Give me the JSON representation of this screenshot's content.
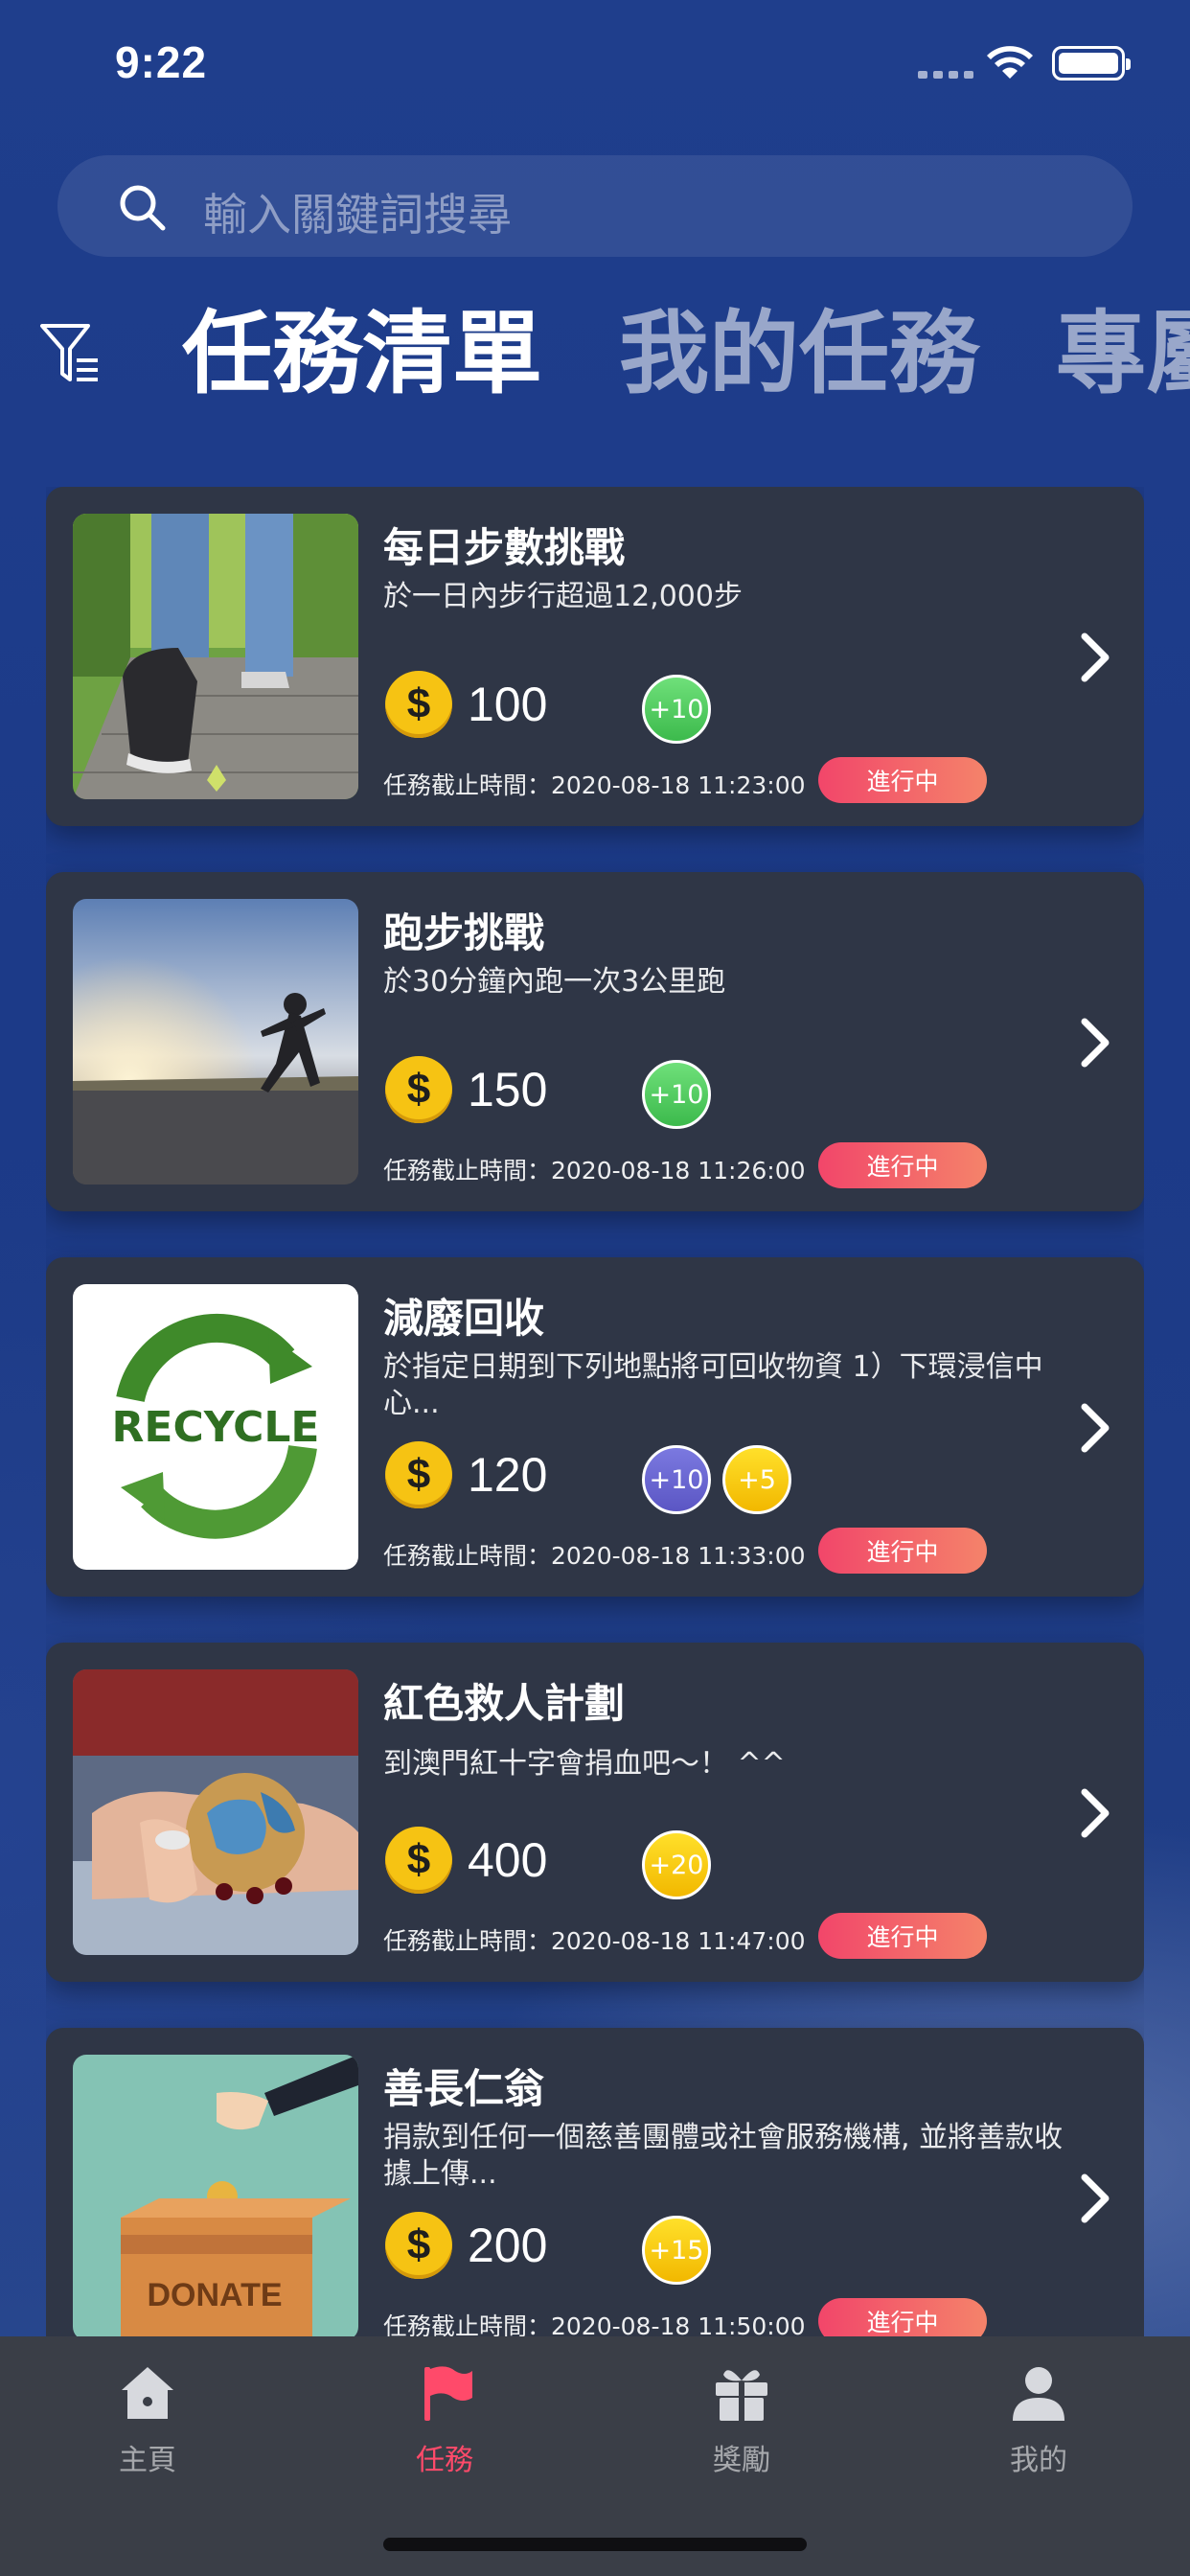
{
  "status_bar": {
    "time": "9:22"
  },
  "search": {
    "placeholder": "輸入關鍵詞搜尋"
  },
  "tabs": [
    {
      "label": "任務清單",
      "active": true
    },
    {
      "label": "我的任務",
      "active": false
    },
    {
      "label": "專屬",
      "active": false
    }
  ],
  "tasks": [
    {
      "title": "每日步數挑戰",
      "description": "於一日內步行超過12,000步",
      "points": "100",
      "bonuses": [
        {
          "label": "+10",
          "color": "green"
        }
      ],
      "deadline": "任務截止時間：2020-08-18 11:23:00",
      "status": "進行中",
      "image": "walking-shoes"
    },
    {
      "title": "跑步挑戰",
      "description": "於30分鐘內跑一次3公里跑",
      "points": "150",
      "bonuses": [
        {
          "label": "+10",
          "color": "green"
        }
      ],
      "deadline": "任務截止時間：2020-08-18 11:26:00",
      "status": "進行中",
      "image": "runner-sunset"
    },
    {
      "title": "減廢回收",
      "description": "於指定日期到下列地點將可回收物資 1）下環浸信中心...",
      "points": "120",
      "bonuses": [
        {
          "label": "+10",
          "color": "purple"
        },
        {
          "label": "+5",
          "color": "yellow"
        }
      ],
      "deadline": "任務截止時間：2020-08-18 11:33:00",
      "status": "進行中",
      "image": "recycle-logo"
    },
    {
      "title": "紅色救人計劃",
      "description": "到澳門紅十字會捐血吧～！ ^^",
      "points": "400",
      "bonuses": [
        {
          "label": "+20",
          "color": "yellow"
        }
      ],
      "deadline": "任務截止時間：2020-08-18 11:47:00",
      "status": "進行中",
      "image": "blood-donation"
    },
    {
      "title": "善長仁翁",
      "description": "捐款到任何一個慈善團體或社會服務機構, 並將善款收據上傳...",
      "points": "200",
      "bonuses": [
        {
          "label": "+15",
          "color": "yellow"
        }
      ],
      "deadline": "任務截止時間：2020-08-18 11:50:00",
      "status": "進行中",
      "image": "donate-box",
      "image_text": "DONATE"
    }
  ],
  "recycle_image_text": "RECYCLE",
  "tab_bar": [
    {
      "label": "主頁",
      "icon": "home-icon",
      "active": false
    },
    {
      "label": "任務",
      "icon": "flag-icon",
      "active": true
    },
    {
      "label": "獎勵",
      "icon": "gift-icon",
      "active": false
    },
    {
      "label": "我的",
      "icon": "person-icon",
      "active": false
    }
  ],
  "colors": {
    "accent": "#ff4a6a",
    "card": "#2f3646",
    "background": "#1d3a86"
  }
}
